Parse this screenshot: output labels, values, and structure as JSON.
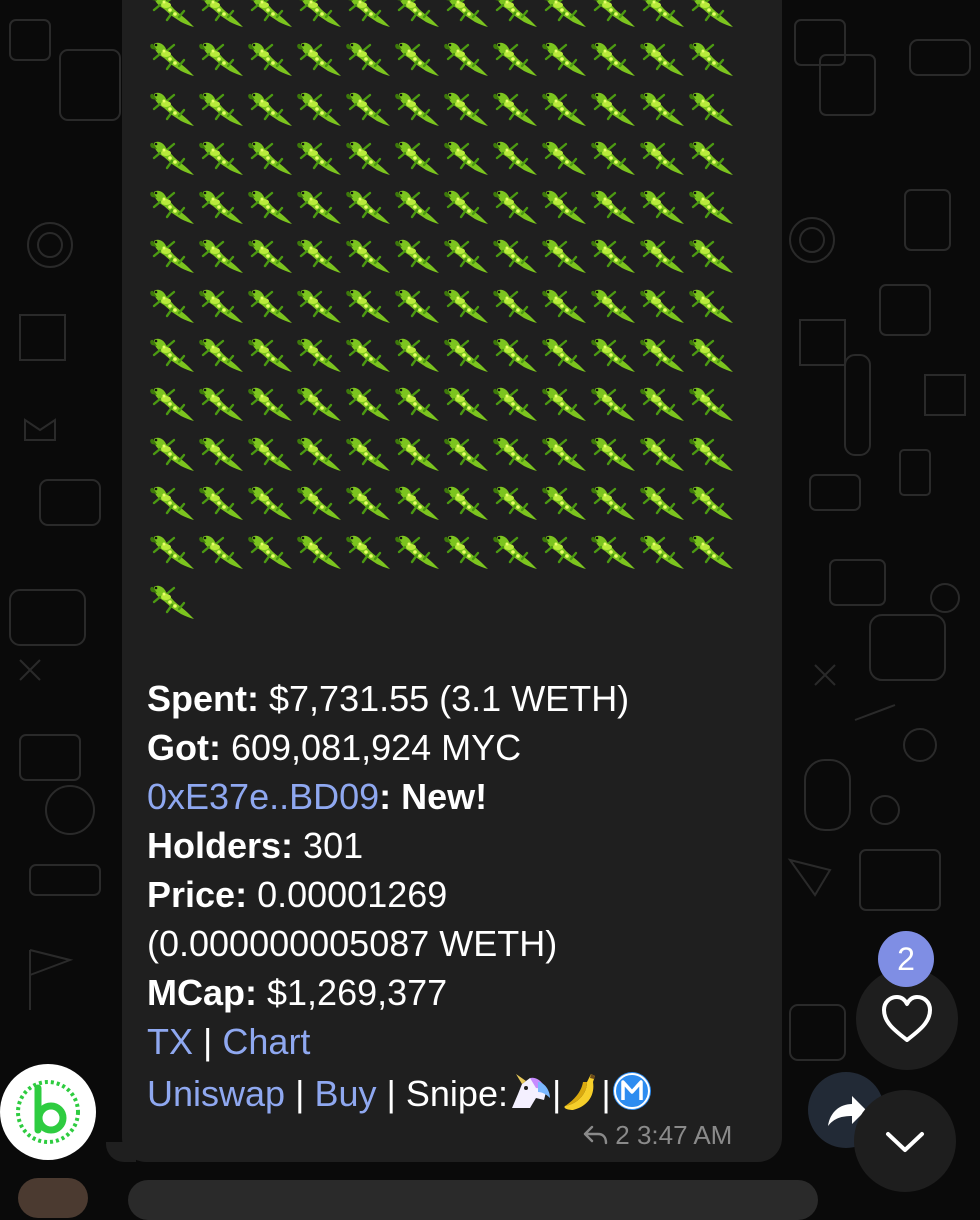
{
  "message": {
    "spent_label": "Spent:",
    "spent_value": "$7,731.55 (3.1 WETH)",
    "got_label": "Got:",
    "got_value": "609,081,924 MYC",
    "address": "0xE37e..BD09",
    "address_suffix": ": New!",
    "holders_label": "Holders:",
    "holders_value": "301",
    "price_label": "Price:",
    "price_value": "0.00001269",
    "price_weth": "(0.000000005087 WETH)",
    "mcap_label": "MCap:",
    "mcap_value": "$1,269,377",
    "tx_link": "TX",
    "separator": "|",
    "chart_link": "Chart",
    "uniswap_link": "Uniswap",
    "buy_link": "Buy",
    "snipe_label": "Snipe:",
    "replies_count": "2",
    "time": "3:47 AM"
  },
  "reaction_badge_count": "2",
  "icons": {
    "emoji": "lizard",
    "inline_emojis": [
      "unicorn",
      "banana",
      "m-circle"
    ],
    "heart": "heart-outline",
    "share": "share-arrow",
    "scroll": "chevron-down",
    "avatar": "green-b-logo"
  },
  "colors": {
    "link": "#8fa8f0",
    "bubble": "#1f1f1f",
    "badge": "#7f8ee4",
    "brand_green": "#2ecc40"
  }
}
